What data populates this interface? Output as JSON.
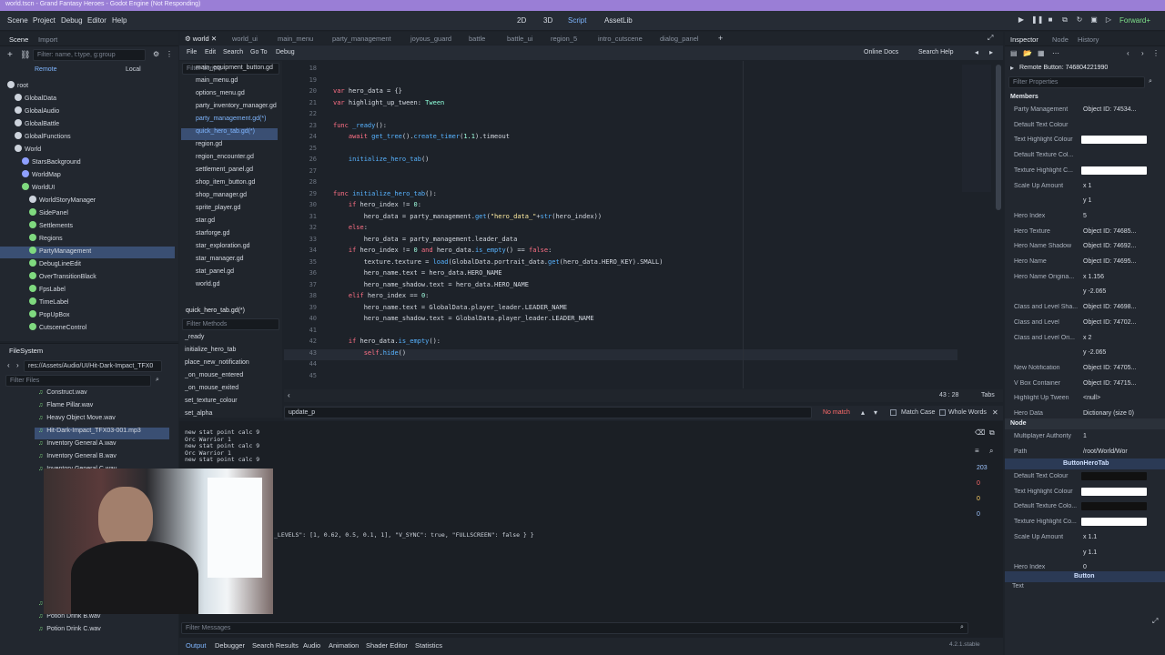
{
  "window_title": "world.tscn - Grand Fantasy Heroes - Godot Engine (Not Responding)",
  "menus": [
    "Scene",
    "Project",
    "Debug",
    "Editor",
    "Help"
  ],
  "workspaces": [
    "2D",
    "3D",
    "Script",
    "AssetLib"
  ],
  "renderer": "Forward+",
  "scene_dock": {
    "tabs": [
      "Scene",
      "Import"
    ],
    "filter_placeholder": "Filter: name, t:type, g:group",
    "remote": "Remote",
    "local": "Local",
    "nodes": [
      {
        "label": "root",
        "indent": 0,
        "color": "#cdd3dc"
      },
      {
        "label": "GlobalData",
        "indent": 1,
        "color": "#cdd3dc"
      },
      {
        "label": "GlobalAudio",
        "indent": 1,
        "color": "#cdd3dc"
      },
      {
        "label": "GlobalBattle",
        "indent": 1,
        "color": "#cdd3dc"
      },
      {
        "label": "GlobalFunctions",
        "indent": 1,
        "color": "#cdd3dc"
      },
      {
        "label": "World",
        "indent": 1,
        "color": "#cdd3dc"
      },
      {
        "label": "StarsBackground",
        "indent": 2,
        "color": "#8fa0ff"
      },
      {
        "label": "WorldMap",
        "indent": 2,
        "color": "#8fa0ff"
      },
      {
        "label": "WorldUI",
        "indent": 2,
        "color": "#7fd97f"
      },
      {
        "label": "WorldStoryManager",
        "indent": 3,
        "color": "#cdd3dc"
      },
      {
        "label": "SidePanel",
        "indent": 3,
        "color": "#7fd97f"
      },
      {
        "label": "Settlements",
        "indent": 3,
        "color": "#7fd97f"
      },
      {
        "label": "Regions",
        "indent": 3,
        "color": "#7fd97f"
      },
      {
        "label": "PartyManagement",
        "indent": 3,
        "color": "#7fd97f"
      },
      {
        "label": "DebugLineEdit",
        "indent": 3,
        "color": "#7fd97f"
      },
      {
        "label": "OverTransitionBlack",
        "indent": 3,
        "color": "#7fd97f"
      },
      {
        "label": "FpsLabel",
        "indent": 3,
        "color": "#7fd97f"
      },
      {
        "label": "TimeLabel",
        "indent": 3,
        "color": "#7fd97f"
      },
      {
        "label": "PopUpBox",
        "indent": 3,
        "color": "#7fd97f"
      },
      {
        "label": "CutsceneControl",
        "indent": 3,
        "color": "#7fd97f"
      }
    ],
    "selected": "PartyManagement"
  },
  "filesystem": {
    "title": "FileSystem",
    "path": "res://Assets/Audio/UI/Hit-Dark-Impact_TFX0",
    "filter_placeholder": "Filter Files",
    "files": [
      "Construct.wav",
      "Flame Pillar.wav",
      "Heavy Object Move.wav",
      "Hit-Dark-Impact_TFX03-001.mp3",
      "Inventory General A.wav",
      "Inventory General B.wav",
      "Inventory General C.wav",
      "Potion Drink A.wav",
      "Potion Drink B.wav",
      "Potion Drink C.wav"
    ],
    "selected": "Hit-Dark-Impact_TFX03-001.mp3"
  },
  "script_tabs": [
    "world",
    "world_ui",
    "main_menu",
    "party_management",
    "joyous_guard",
    "battle",
    "battle_ui",
    "region_5",
    "intro_cutscene",
    "dialog_panel"
  ],
  "script_menu": [
    "File",
    "Edit",
    "Search",
    "Go To",
    "Debug"
  ],
  "online_docs": "Online Docs",
  "search_help": "Search Help",
  "filter_scripts": "Filter Scripts",
  "scripts": [
    "main_equipment_button.gd",
    "main_menu.gd",
    "options_menu.gd",
    "party_inventory_manager.gd",
    "party_management.gd(*)",
    "quick_hero_tab.gd(*)",
    "region.gd",
    "region_encounter.gd",
    "settlement_panel.gd",
    "shop_item_button.gd",
    "shop_manager.gd",
    "sprite_player.gd",
    "star.gd",
    "starforge.gd",
    "star_exploration.gd",
    "star_manager.gd",
    "stat_panel.gd",
    "world.gd"
  ],
  "selected_script": "quick_hero_tab.gd(*)",
  "current_script_label": "quick_hero_tab.gd(*)",
  "filter_methods": "Filter Methods",
  "methods": [
    "_ready",
    "initialize_hero_tab",
    "place_new_notification",
    "_on_mouse_entered",
    "_on_mouse_exited",
    "set_texture_colour",
    "set_alpha"
  ],
  "code": [
    {
      "n": "18",
      "t": ""
    },
    {
      "n": "19",
      "t": ""
    },
    {
      "n": "20",
      "t": "var hero_data = {}"
    },
    {
      "n": "21",
      "t": "var highlight_up_tween: Tween"
    },
    {
      "n": "22",
      "t": ""
    },
    {
      "n": "23",
      "t": "func _ready():"
    },
    {
      "n": "24",
      "t": "    await get_tree().create_timer(1.1).timeout"
    },
    {
      "n": "25",
      "t": ""
    },
    {
      "n": "26",
      "t": "    initialize_hero_tab()"
    },
    {
      "n": "27",
      "t": ""
    },
    {
      "n": "28",
      "t": ""
    },
    {
      "n": "29",
      "t": "func initialize_hero_tab():"
    },
    {
      "n": "30",
      "t": "    if hero_index != 0:"
    },
    {
      "n": "31",
      "t": "        hero_data = party_management.get(\"hero_data_\"+str(hero_index))"
    },
    {
      "n": "32",
      "t": "    else:"
    },
    {
      "n": "33",
      "t": "        hero_data = party_management.leader_data"
    },
    {
      "n": "34",
      "t": "    if hero_index != 0 and hero_data.is_empty() == false:"
    },
    {
      "n": "35",
      "t": "        texture.texture = load(GlobalData.portrait_data.get(hero_data.HERO_KEY).SMALL)"
    },
    {
      "n": "36",
      "t": "        hero_name.text = hero_data.HERO_NAME"
    },
    {
      "n": "37",
      "t": "        hero_name_shadow.text = hero_data.HERO_NAME"
    },
    {
      "n": "38",
      "t": "    elif hero_index == 0:"
    },
    {
      "n": "39",
      "t": "        hero_name.text = GlobalData.player_leader.LEADER_NAME"
    },
    {
      "n": "40",
      "t": "        hero_name_shadow.text = GlobalData.player_leader.LEADER_NAME"
    },
    {
      "n": "41",
      "t": ""
    },
    {
      "n": "42",
      "t": "    if hero_data.is_empty():"
    },
    {
      "n": "43",
      "t": "        self.hide()"
    },
    {
      "n": "44",
      "t": ""
    },
    {
      "n": "45",
      "t": ""
    }
  ],
  "cursor_pos": "43 :  28",
  "tabs_label": "Tabs",
  "find_bar": {
    "query": "update_p",
    "status": "No match",
    "match_case": "Match Case",
    "whole_words": "Whole Words"
  },
  "output": [
    "new stat point calc 9",
    "Orc Warrior 1",
    "new stat point calc 9",
    "Orc Warrior 1",
    "new stat point calc 9"
  ],
  "output_tail": "_LEVELS\": [1, 0.62, 0.5, 0.1, 1], \"V_SYNC\": true, \"FULLSCREEN\": false } }",
  "output_counts": [
    "203",
    "0",
    "0",
    "0"
  ],
  "filter_messages": "Filter Messages",
  "bottom_tabs": [
    "Output",
    "Debugger",
    "Search Results",
    "Audio",
    "Animation",
    "Shader Editor",
    "Statistics"
  ],
  "version": "4.2.1.stable",
  "inspector": {
    "tabs": [
      "Inspector",
      "Node",
      "History"
    ],
    "remote_label": "Remote Button: 746804221990",
    "filter": "Filter Properties",
    "members": "Members",
    "rows": [
      {
        "k": "Party Management",
        "v": "Object ID: 74534..."
      },
      {
        "k": "Default Text Colour",
        "v": ""
      },
      {
        "k": "Text Highlight Colour",
        "v": "",
        "color": "white"
      },
      {
        "k": "Default Texture Col...",
        "v": ""
      },
      {
        "k": "Texture Highlight C...",
        "v": "",
        "color": "white"
      },
      {
        "k": "Scale Up Amount",
        "v": "x  1"
      },
      {
        "k": "",
        "v": "y  1"
      },
      {
        "k": "Hero Index",
        "v": "5"
      },
      {
        "k": "Hero Texture",
        "v": "Object ID: 74685..."
      },
      {
        "k": "Hero Name Shadow",
        "v": "Object ID: 74692..."
      },
      {
        "k": "Hero Name",
        "v": "Object ID: 74695..."
      },
      {
        "k": "Hero Name Origina...",
        "v": "x  1.156"
      },
      {
        "k": "",
        "v": "y  -2.065"
      },
      {
        "k": "Class and Level Sha...",
        "v": "Object ID: 74698..."
      },
      {
        "k": "Class and Level",
        "v": "Object ID: 74702..."
      },
      {
        "k": "Class and Level Ori...",
        "v": "x  2"
      },
      {
        "k": "",
        "v": "y  -2.065"
      },
      {
        "k": "New Notification",
        "v": "Object ID: 74705..."
      },
      {
        "k": "V Box Container",
        "v": "Object ID: 74715..."
      },
      {
        "k": "Highlight Up Tween",
        "v": "<null>"
      },
      {
        "k": "Hero Data",
        "v": "Dictionary (size 0)"
      }
    ],
    "node_section": "Node",
    "node_rows": [
      {
        "k": "Multiplayer Authority",
        "v": "1"
      },
      {
        "k": "Path",
        "v": "/root/World/Wor"
      }
    ],
    "script_section": "ButtonHeroTab",
    "script_rows": [
      {
        "k": "Default Text Colour",
        "v": "",
        "color": "dark"
      },
      {
        "k": "Text Highlight Colour",
        "v": "",
        "color": "white"
      },
      {
        "k": "Default Texture Colo...",
        "v": "",
        "color": "dark"
      },
      {
        "k": "Texture Highlight Co...",
        "v": "",
        "color": "white"
      },
      {
        "k": "Scale Up Amount",
        "v": "x  1.1"
      },
      {
        "k": "",
        "v": "y  1.1"
      },
      {
        "k": "Hero Index",
        "v": "0"
      }
    ],
    "button_section": "Button",
    "text_label": "Text"
  }
}
